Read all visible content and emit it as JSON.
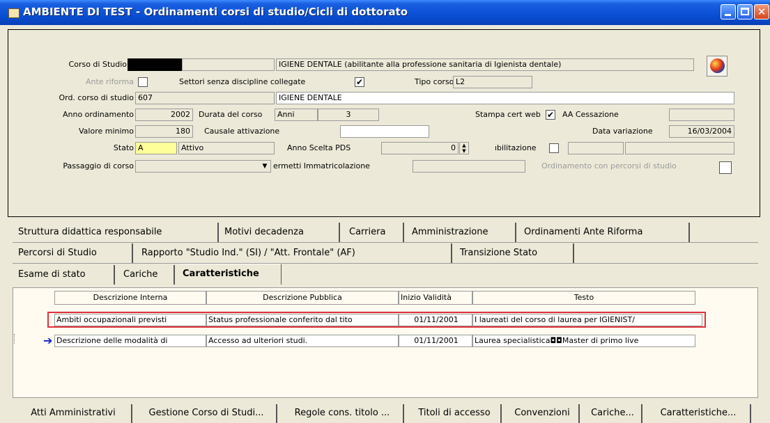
{
  "window": {
    "title": "AMBIENTE DI TEST - Ordinamenti corsi di studio/Cicli di dottorato",
    "close_glyph": "✕"
  },
  "form": {
    "corso_di_studio_label": "Corso di Studio",
    "corso_di_studio_desc": "IGIENE DENTALE (abilitante alla professione sanitaria di Igienista dentale)",
    "ante_riforma_label": "Ante riforma",
    "settori_label": "Settori senza discipline collegate",
    "settori_checked": "✔",
    "tipo_corso_label": "Tipo corso",
    "tipo_corso_value": "L2",
    "ord_corso_label": "Ord. corso di studio",
    "ord_corso_code": "607",
    "ord_corso_desc": "IGIENE DENTALE",
    "anno_ordinamento_label": "Anno ordinamento",
    "anno_ordinamento_value": "2002",
    "durata_label": "Durata del corso",
    "durata_unit": "Anni",
    "durata_value": "3",
    "stampa_label": "Stampa cert web",
    "stampa_checked": "✔",
    "aa_cessazione_label": "AA Cessazione",
    "aa_cessazione_value": "",
    "valore_minimo_label": "Valore minimo",
    "valore_minimo_value": "180",
    "causale_label": "Causale attivazione",
    "causale_value": "",
    "data_variazione_label": "Data variazione",
    "data_variazione_value": "16/03/2004",
    "stato_label": "Stato",
    "stato_code": "A",
    "stato_desc": "Attivo",
    "anno_scelta_label": "Anno Scelta PDS",
    "anno_scelta_value": "0",
    "abilitazione_label": "ıbilitazione",
    "passaggio_label": "Passaggio di corso",
    "passaggio_value": "",
    "permetti_label": "ermetti Immatricolazione",
    "ordinamento_percorsi_label": "Ordinamento con percorsi di studio"
  },
  "tabs": {
    "row1": [
      "Struttura didattica responsabile",
      "Motivi decadenza",
      "Carriera",
      "Amministrazione",
      "Ordinamenti Ante Riforma"
    ],
    "row2": [
      "Percorsi di Studio",
      "Rapporto \"Studio Ind.\" (SI) / \"Att. Frontale\" (AF)",
      "Transizione Stato"
    ],
    "row3": [
      "Esame di stato",
      "Cariche",
      "Caratteristiche"
    ]
  },
  "table": {
    "columns": [
      "Descrizione Interna",
      "Descrizione Pubblica",
      "Inizio Validità",
      "Testo"
    ],
    "rows": [
      [
        "Ambiti occupazionali previsti",
        "Status professionale conferito dal tito",
        "01/11/2001",
        "I laureati del corso di laurea per IGIENIST/"
      ],
      [
        "Descrizione delle modalità di",
        "Accesso ad ulteriori studi.",
        "01/11/2001",
        "Laurea specialistica◘◘Master di primo live"
      ]
    ],
    "current_row_marker": "➔"
  },
  "bottom_buttons": [
    "Atti Amministrativi",
    "Gestione Corso di Studi...",
    "Regole cons. titolo ...",
    "Titoli di accesso",
    "Convenzioni",
    "Cariche...",
    "Caratteristiche..."
  ],
  "colors": {
    "titlebar": "#0a4fd4",
    "highlight_border": "#e0303a",
    "yellow_field": "#ffff99"
  }
}
